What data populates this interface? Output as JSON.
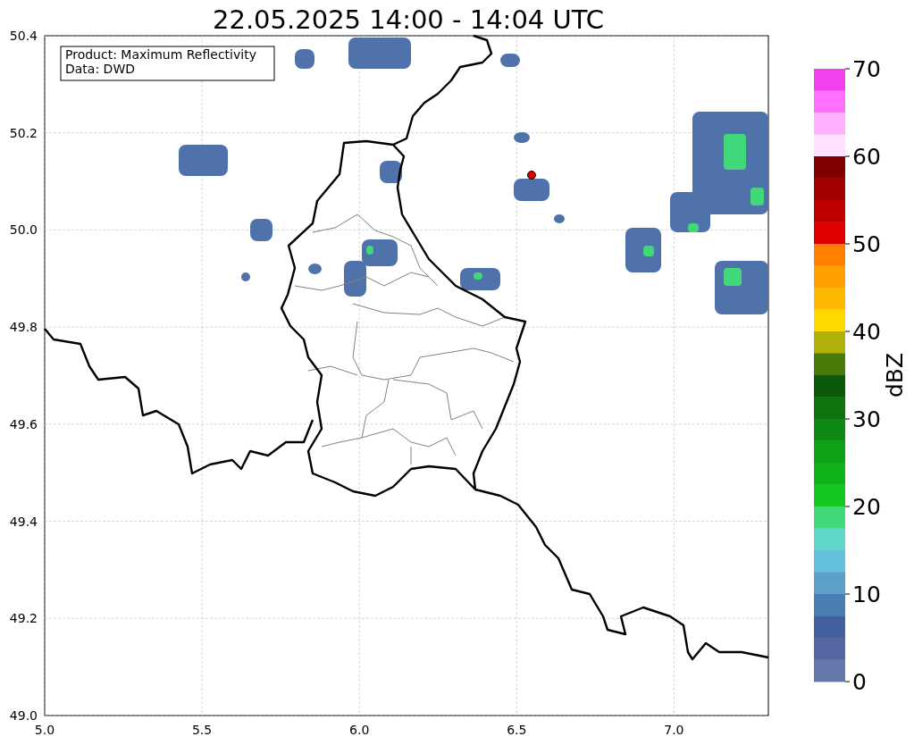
{
  "title": "22.05.2025 14:00 - 14:04 UTC",
  "legend": [
    "Product: Maximum Reflectivity",
    "Data: DWD"
  ],
  "x_ticks": [
    "5.0",
    "5.5",
    "6.0",
    "6.5",
    "7.0"
  ],
  "y_ticks": [
    "50.4",
    "50.2",
    "50.0",
    "49.8",
    "49.6",
    "49.4",
    "49.2",
    "49.0"
  ],
  "colorbar": {
    "label": "dBZ",
    "ticks": [
      "70",
      "60",
      "50",
      "40",
      "30",
      "20",
      "10",
      "0"
    ],
    "segments": [
      {
        "color": "#f040f0"
      },
      {
        "color": "#ff70ff"
      },
      {
        "color": "#ffb0ff"
      },
      {
        "color": "#ffe0ff"
      },
      {
        "color": "#800000"
      },
      {
        "color": "#a00000"
      },
      {
        "color": "#c00000"
      },
      {
        "color": "#e00000"
      },
      {
        "color": "#ff8000"
      },
      {
        "color": "#ffa000"
      },
      {
        "color": "#ffb800"
      },
      {
        "color": "#ffd800"
      },
      {
        "color": "#b0b00a"
      },
      {
        "color": "#4a7a0a"
      },
      {
        "color": "#0a5a0a"
      },
      {
        "color": "#0e7410"
      },
      {
        "color": "#0e8a14"
      },
      {
        "color": "#10a216"
      },
      {
        "color": "#10b41a"
      },
      {
        "color": "#14c822"
      },
      {
        "color": "#40d878"
      },
      {
        "color": "#60d8c8"
      },
      {
        "color": "#62c0da"
      },
      {
        "color": "#5a9fc8"
      },
      {
        "color": "#4a7db2"
      },
      {
        "color": "#43609f"
      },
      {
        "color": "#5566a2"
      },
      {
        "color": "#6677aa"
      }
    ]
  }
}
